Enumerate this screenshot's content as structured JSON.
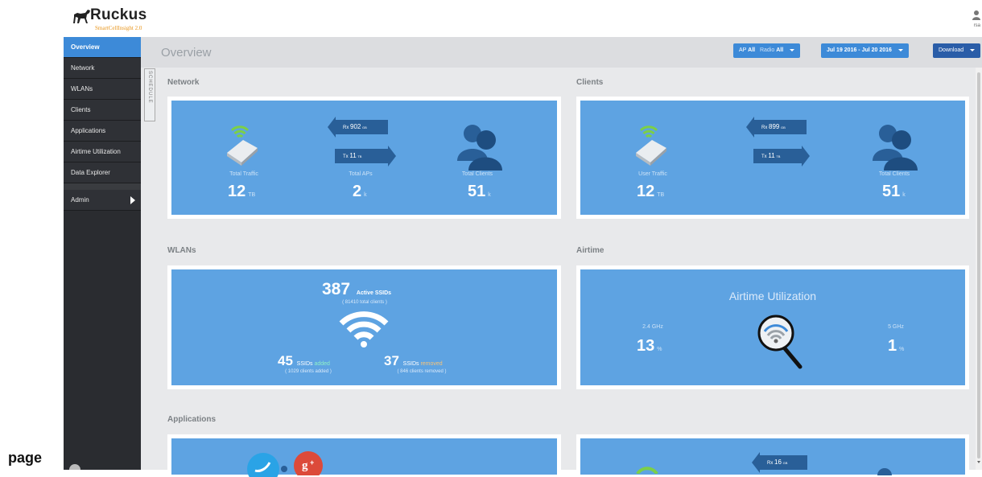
{
  "brand": {
    "name": "Ruckus",
    "sub": "SmartCellInsight 2.0"
  },
  "user": {
    "name": "rsa"
  },
  "sidebar": {
    "items": [
      {
        "label": "Overview"
      },
      {
        "label": "Network"
      },
      {
        "label": "WLANs"
      },
      {
        "label": "Clients"
      },
      {
        "label": "Applications"
      },
      {
        "label": "Airtime Utilization"
      },
      {
        "label": "Data Explorer"
      }
    ],
    "admin": "Admin"
  },
  "header": {
    "title": "Overview",
    "ap_label": "AP",
    "ap_value": "All",
    "radio_label": "Radio",
    "radio_value": "All",
    "date_range": "Jul 19 2016 - Jul 20 2016",
    "download": "Download"
  },
  "schedule_label": "SCHEDULE",
  "network": {
    "title": "Network",
    "rx_label": "Rx",
    "rx_value": "902",
    "rx_unit": "GB",
    "tx_label": "Tx",
    "tx_value": "11",
    "tx_unit": "TB",
    "traffic_label": "Total Traffic",
    "traffic_value": "12",
    "traffic_unit": "TB",
    "aps_label": "Total APs",
    "aps_value": "2",
    "aps_unit": "k",
    "clients_label": "Total Clients",
    "clients_value": "51",
    "clients_unit": "k"
  },
  "clients": {
    "title": "Clients",
    "rx_label": "Rx",
    "rx_value": "899",
    "rx_unit": "GB",
    "tx_label": "Tx",
    "tx_value": "11",
    "tx_unit": "TB",
    "traffic_label": "User Traffic",
    "traffic_value": "12",
    "traffic_unit": "TB",
    "clients_label": "Total Clients",
    "clients_value": "51",
    "clients_unit": "k"
  },
  "wlans": {
    "title": "WLANs",
    "active_value": "387",
    "active_label": "Active SSIDs",
    "total_clients": "( 81410 total clients )",
    "added_value": "45",
    "added_ssids": "SSIDs",
    "added_word": "added",
    "added_clients": "( 1029 clients added )",
    "removed_value": "37",
    "removed_ssids": "SSIDs",
    "removed_word": "removed",
    "removed_clients": "( 846 clients removed )"
  },
  "airtime": {
    "title": "Airtime",
    "card_title": "Airtime Utilization",
    "ghz24_label": "2.4 GHz",
    "ghz24_value": "13",
    "ghz24_unit": "%",
    "ghz5_label": "5 GHz",
    "ghz5_value": "1",
    "ghz5_unit": "%"
  },
  "applications": {
    "title": "Applications",
    "rx_label": "Rx",
    "rx_value": "16",
    "rx_unit": "GB"
  },
  "page_label": "page",
  "colors": {
    "accent": "#3d8ad8",
    "card": "#5ea3e2",
    "sidebar": "#2a2c30",
    "arrow": "#295f98"
  }
}
